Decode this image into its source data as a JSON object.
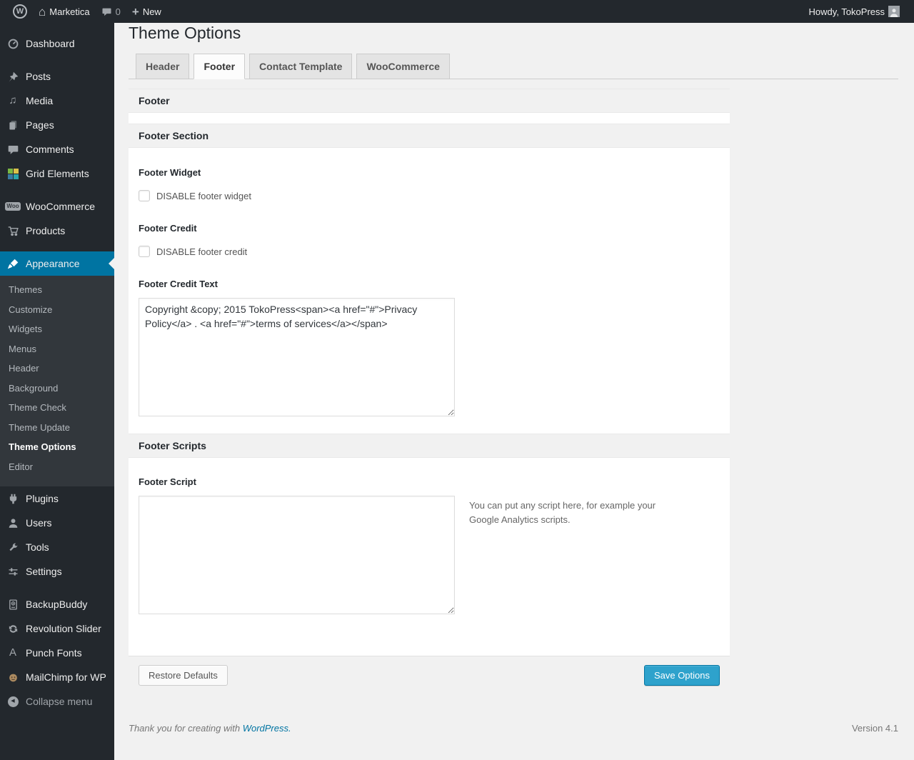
{
  "admin_bar": {
    "site_name": "Marketica",
    "comment_count": "0",
    "new_label": "New",
    "howdy": "Howdy, TokoPress"
  },
  "icons": {
    "wp_logo": "W",
    "home": "⌂",
    "plus": "+",
    "media_note": "♫",
    "woo_badge": "Woo",
    "punch_fonts": "A",
    "collapse_arrow": "◀"
  },
  "sidebar": {
    "items": [
      {
        "label": "Dashboard"
      },
      {
        "label": "Posts"
      },
      {
        "label": "Media"
      },
      {
        "label": "Pages"
      },
      {
        "label": "Comments"
      },
      {
        "label": "Grid Elements"
      },
      {
        "label": "WooCommerce"
      },
      {
        "label": "Products"
      },
      {
        "label": "Appearance"
      },
      {
        "label": "Plugins"
      },
      {
        "label": "Users"
      },
      {
        "label": "Tools"
      },
      {
        "label": "Settings"
      },
      {
        "label": "BackupBuddy"
      },
      {
        "label": "Revolution Slider"
      },
      {
        "label": "Punch Fonts"
      },
      {
        "label": "MailChimp for WP"
      },
      {
        "label": "Collapse menu"
      }
    ],
    "appearance_submenu": [
      "Themes",
      "Customize",
      "Widgets",
      "Menus",
      "Header",
      "Background",
      "Theme Check",
      "Theme Update",
      "Theme Options",
      "Editor"
    ]
  },
  "page": {
    "title": "Theme Options",
    "tabs": [
      {
        "label": "Header"
      },
      {
        "label": "Footer"
      },
      {
        "label": "Contact Template"
      },
      {
        "label": "WooCommerce"
      }
    ]
  },
  "panel": {
    "section_footer": "Footer",
    "section_footer_section": "Footer Section",
    "section_footer_scripts": "Footer Scripts",
    "footer_widget_label": "Footer Widget",
    "footer_widget_checkbox": "DISABLE footer widget",
    "footer_credit_label": "Footer Credit",
    "footer_credit_checkbox": "DISABLE footer credit",
    "footer_credit_text_label": "Footer Credit Text",
    "footer_credit_text_value": "Copyright &copy; 2015 TokoPress<span><a href=\"#\">Privacy Policy</a> . <a href=\"#\">terms of services</a></span>",
    "footer_script_label": "Footer Script",
    "footer_script_value": "",
    "footer_script_help": "You can put any script here, for example your Google Analytics scripts.",
    "restore_button": "Restore Defaults",
    "save_button": "Save Options"
  },
  "page_footer": {
    "thanks": "Thank you for creating with",
    "wordpress_link": "WordPress.",
    "version": "Version 4.1"
  },
  "colors": {
    "accent": "#0074a2",
    "primary_button": "#2ea2cc",
    "admin_bar_bg": "#23282d",
    "submenu_bg": "#32373c",
    "content_bg": "#f1f1f1"
  }
}
